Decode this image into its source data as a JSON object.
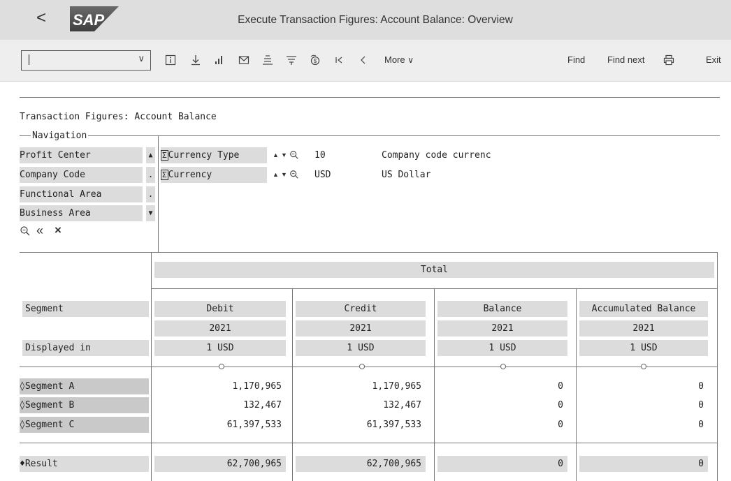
{
  "header": {
    "back": "<",
    "logo_text": "SAP",
    "title": "Execute Transaction Figures: Account Balance: Overview"
  },
  "toolbar": {
    "command_field_value": "",
    "icons": [
      "info-icon",
      "download-icon",
      "chart-icon",
      "mail-icon",
      "align-icon",
      "filter-icon",
      "currency-icon",
      "first-icon",
      "previous-icon"
    ],
    "more_label": "More",
    "find_label": "Find",
    "find_next_label": "Find next",
    "exit_label": "Exit"
  },
  "report": {
    "title": "Transaction Figures: Account Balance",
    "navigation_label": "Navigation",
    "nav_items": [
      {
        "label": "Profit Center",
        "marker": "▲"
      },
      {
        "label": "Company Code",
        "marker": "."
      },
      {
        "label": "Functional Area",
        "marker": "."
      },
      {
        "label": "Business Area",
        "marker": "▼"
      }
    ],
    "filters": [
      {
        "sigma": "Σ",
        "label": "Currency Type",
        "key": "10",
        "text": "Company code currenc"
      },
      {
        "sigma": "Σ",
        "label": "Currency",
        "key": "USD",
        "text": "US Dollar"
      }
    ],
    "nav_actions": [
      "zoom-icon",
      "collapse-icon",
      "close-icon"
    ]
  },
  "table": {
    "total_label": "Total",
    "segment_header": "Segment",
    "displayed_in_label": "Displayed in",
    "columns": [
      {
        "label": "Debit",
        "year": "2021",
        "unit": "1 USD"
      },
      {
        "label": "Credit",
        "year": "2021",
        "unit": "1 USD"
      },
      {
        "label": "Balance",
        "year": "2021",
        "unit": "1 USD"
      },
      {
        "label": "Accumulated Balance",
        "year": "2021",
        "unit": "1 USD"
      }
    ],
    "rows": [
      {
        "label": "◊Segment A",
        "values": [
          "1,170,965",
          "1,170,965",
          "0",
          "0"
        ]
      },
      {
        "label": "◊Segment B",
        "values": [
          "132,467",
          "132,467",
          "0",
          "0"
        ]
      },
      {
        "label": "◊Segment C",
        "values": [
          "61,397,533",
          "61,397,533",
          "0",
          "0"
        ]
      }
    ],
    "result": {
      "label": "♦Result",
      "values": [
        "62,700,965",
        "62,700,965",
        "0",
        "0"
      ]
    }
  }
}
